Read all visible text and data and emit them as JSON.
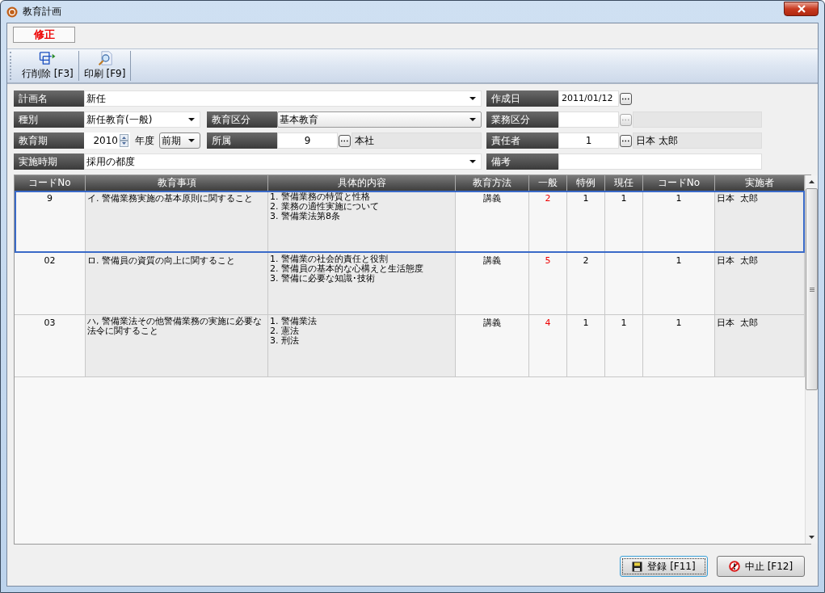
{
  "window": {
    "title": "教育計画"
  },
  "mode": "修正",
  "toolbar": [
    {
      "kind": "delete-row",
      "label": "行削除 [F3]"
    },
    {
      "kind": "print",
      "label": "印刷 [F9]"
    }
  ],
  "form": [
    {
      "left": [
        {
          "kind": "label",
          "text": "計画名"
        },
        {
          "kind": "combo",
          "value": "新任"
        }
      ],
      "right": [
        {
          "kind": "label",
          "text": "作成日"
        },
        {
          "kind": "date",
          "value": "2011/01/12"
        }
      ]
    },
    {
      "left": [
        {
          "kind": "label",
          "text": "種別"
        },
        {
          "kind": "combo",
          "value": "新任教育(一般)"
        },
        {
          "kind": "label",
          "text": "教育区分"
        },
        {
          "kind": "combo",
          "value": "基本教育"
        }
      ],
      "right": [
        {
          "kind": "label",
          "text": "業務区分"
        },
        {
          "kind": "lookup",
          "disabled": true
        }
      ]
    },
    {
      "left": [
        {
          "kind": "label",
          "text": "教育期"
        },
        {
          "kind": "spin",
          "value": "2010"
        },
        {
          "kind": "text",
          "text": "年度"
        },
        {
          "kind": "combo",
          "value": "前期"
        },
        {
          "kind": "label",
          "text": "所属"
        },
        {
          "kind": "lookup",
          "code": "9",
          "name": "本社",
          "disabled": false
        }
      ],
      "right": [
        {
          "kind": "label",
          "text": "責任者"
        },
        {
          "kind": "lookup",
          "code": "1",
          "name": "日本  太郎",
          "disabled": false
        }
      ]
    },
    {
      "left": [
        {
          "kind": "label",
          "text": "実施時期"
        },
        {
          "kind": "combo",
          "value": "採用の都度"
        }
      ],
      "right": [
        {
          "kind": "label",
          "text": "備考"
        },
        {
          "kind": "field"
        }
      ]
    }
  ],
  "table": {
    "columns": [
      "コードNo",
      "教育事項",
      "具体的内容",
      "教育方法",
      "一般",
      "特例",
      "現任",
      "コードNo",
      "実施者"
    ],
    "rows": [
      {
        "selected": true,
        "code": "9",
        "item": "イ. 警備業務実施の基本原則に関すること",
        "content": [
          "1. 警備業務の特質と性格",
          "2. 業務の適性実施について",
          "3. 警備業法第8条"
        ],
        "method": "講義",
        "general": "2",
        "special": "1",
        "current": "1",
        "code_2": "1",
        "instructor": "日本  太郎"
      },
      {
        "selected": false,
        "code": "02",
        "item": "ロ. 警備員の資質の向上に関すること",
        "content": [
          "1. 警備業の社会的責任と役割",
          "2. 警備員の基本的な心構えと生活態度",
          "3. 警備に必要な知識･技術"
        ],
        "method": "講義",
        "general": "5",
        "special": "2",
        "code_2": "1",
        "instructor": "日本  太郎"
      },
      {
        "selected": false,
        "code": "03",
        "item": "ハ, 警備業法その他警備業務の実施に必要な法令に関すること",
        "content": [
          "1. 警備業法",
          "2. 憲法",
          "3. 刑法"
        ],
        "method": "講義",
        "general": "4",
        "special": "1",
        "current": "1",
        "code_2": "1",
        "instructor": "日本  太郎"
      }
    ]
  },
  "buttons": [
    {
      "kind": "save",
      "label": "登録 [F11]",
      "focused": true
    },
    {
      "kind": "cancel",
      "label": "中止 [F12]",
      "focused": false
    }
  ]
}
